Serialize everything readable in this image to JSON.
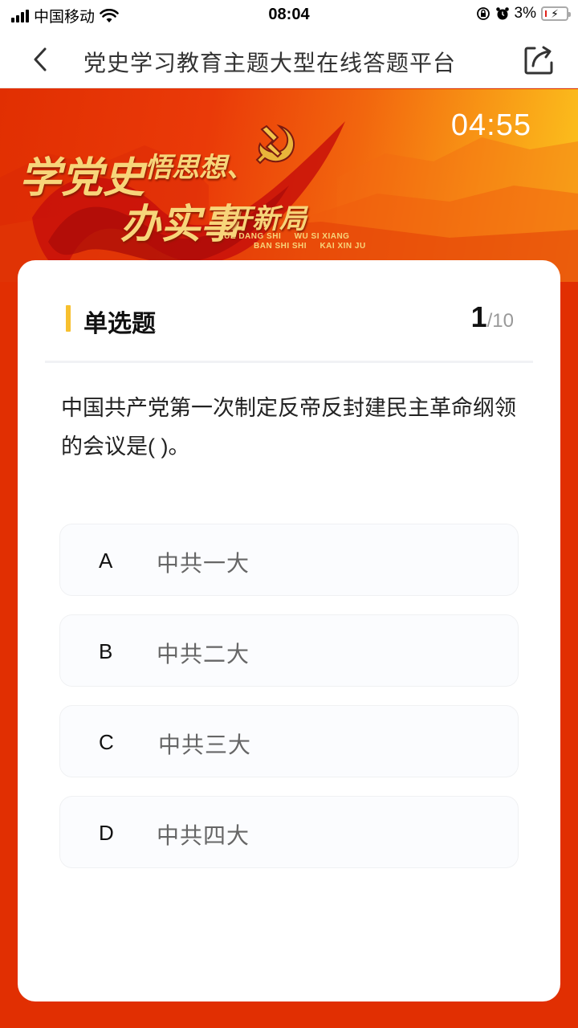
{
  "status_bar": {
    "carrier": "中国移动",
    "time": "08:04",
    "battery_percent": "3%",
    "icons": [
      "signal-icon",
      "wifi-icon",
      "rotation-lock-icon",
      "alarm-icon",
      "battery-charging-icon"
    ]
  },
  "nav": {
    "title": "党史学习教育主题大型在线答题平台",
    "back_icon": "chevron-left-icon",
    "share_icon": "share-icon"
  },
  "banner": {
    "timer": "04:55",
    "slogan_line1_a": "学党史",
    "slogan_line1_b": "悟思想、",
    "slogan_line2_a": "办实事",
    "slogan_line2_b": "开新局",
    "pinyin_line1": "XUE DANG SHI     WU SI XIANG",
    "pinyin_line2": "BAN SHI SHI     KAI XIN JU",
    "emblem_icon": "party-emblem-icon",
    "colors": {
      "start": "#e12f02",
      "end": "#fcc61e",
      "gold": "#f7d57a"
    }
  },
  "question": {
    "type_label": "单选题",
    "current": "1",
    "total": "/10",
    "text": "中国共产党第一次制定反帝反封建民主革命纲领的会议是(     )。",
    "options": [
      {
        "letter": "A",
        "text": "中共一大"
      },
      {
        "letter": "B",
        "text": "中共二大"
      },
      {
        "letter": "C",
        "text": "中共三大"
      },
      {
        "letter": "D",
        "text": "中共四大"
      }
    ]
  },
  "theme": {
    "page_background": "#e12f02",
    "accent_bar": "#f7c02e"
  }
}
